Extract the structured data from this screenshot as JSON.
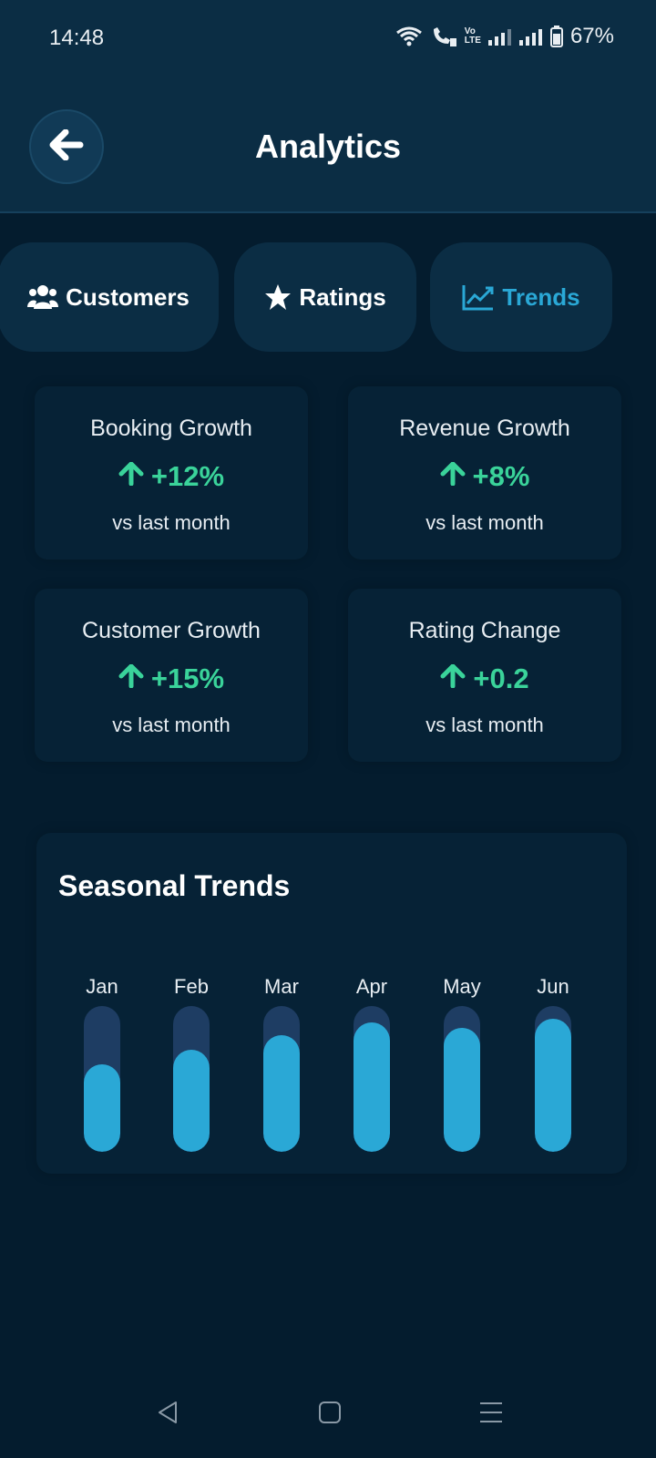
{
  "status_bar": {
    "time": "14:48",
    "volte_label_top": "Vo",
    "volte_label_bottom": "LTE",
    "battery": "67%"
  },
  "header": {
    "title": "Analytics",
    "back_icon": "arrow-left-icon"
  },
  "tabs": [
    {
      "label": "Customers",
      "icon": "users-icon",
      "active": false
    },
    {
      "label": "Ratings",
      "icon": "star-icon",
      "active": false
    },
    {
      "label": "Trends",
      "icon": "chart-line-icon",
      "active": true
    }
  ],
  "stats": [
    {
      "title": "Booking Growth",
      "value": "+12%",
      "note": "vs last month"
    },
    {
      "title": "Revenue Growth",
      "value": "+8%",
      "note": "vs last month"
    },
    {
      "title": "Customer Growth",
      "value": "+15%",
      "note": "vs last month"
    },
    {
      "title": "Rating Change",
      "value": "+0.2",
      "note": "vs last month"
    }
  ],
  "seasonal_trends": {
    "title": "Seasonal Trends"
  },
  "chart_data": {
    "type": "bar",
    "categories": [
      "Jan",
      "Feb",
      "Mar",
      "Apr",
      "May",
      "Jun"
    ],
    "values": [
      60,
      70,
      80,
      89,
      85,
      91
    ],
    "ylim": [
      0,
      100
    ]
  },
  "colors": {
    "background": "#041c2e",
    "surface": "#0b2d44",
    "accent": "#2aa8d6",
    "positive": "#3ad39a",
    "bar_track": "#1e3d63"
  }
}
